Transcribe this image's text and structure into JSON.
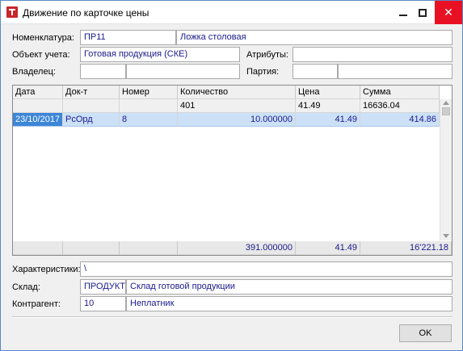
{
  "window": {
    "title": "Движение по карточке цены",
    "minimize_icon": "minimize-icon",
    "maximize_icon": "maximize-icon",
    "close_icon": "close-icon",
    "close_glyph": "✕"
  },
  "form": {
    "nomenclature_label": "Номенклатура:",
    "nomenclature_code": "ПР11",
    "nomenclature_name": "Ложка столовая",
    "account_object_label": "Объект учета:",
    "account_object_value": "Готовая продукция (СКЕ)",
    "attributes_label": "Атрибуты:",
    "attributes_value": "",
    "owner_label": "Владелец:",
    "owner_code": "",
    "owner_name": "",
    "batch_label": "Партия:",
    "batch_code": "",
    "batch_name": ""
  },
  "table": {
    "columns": [
      "Дата",
      "Док-т",
      "Номер",
      "Количество",
      "Цена",
      "Сумма"
    ],
    "summary_row": [
      "",
      "",
      "",
      "401",
      "41.49",
      "16636.04"
    ],
    "rows": [
      [
        "23/10/2017",
        "РсОрд",
        "8",
        "10.000000",
        "41.49",
        "414.86"
      ]
    ],
    "footer": [
      "",
      "",
      "",
      "391.000000",
      "41.49",
      "16'221.18"
    ]
  },
  "bottom": {
    "characteristics_label": "Характеристики:",
    "characteristics_value": "\\",
    "warehouse_label": "Склад:",
    "warehouse_code": "ПРОДУКТ",
    "warehouse_name": "Склад готовой продукции",
    "counterparty_label": "Контрагент:",
    "counterparty_code": "10",
    "counterparty_name": "Неплатник"
  },
  "buttons": {
    "ok_label": "OK"
  },
  "colors": {
    "title_close_bg": "#e81123",
    "selected_row_bg": "#cce1f7",
    "selected_cell_bg": "#3c86d8",
    "field_text": "#1a1a8c"
  }
}
